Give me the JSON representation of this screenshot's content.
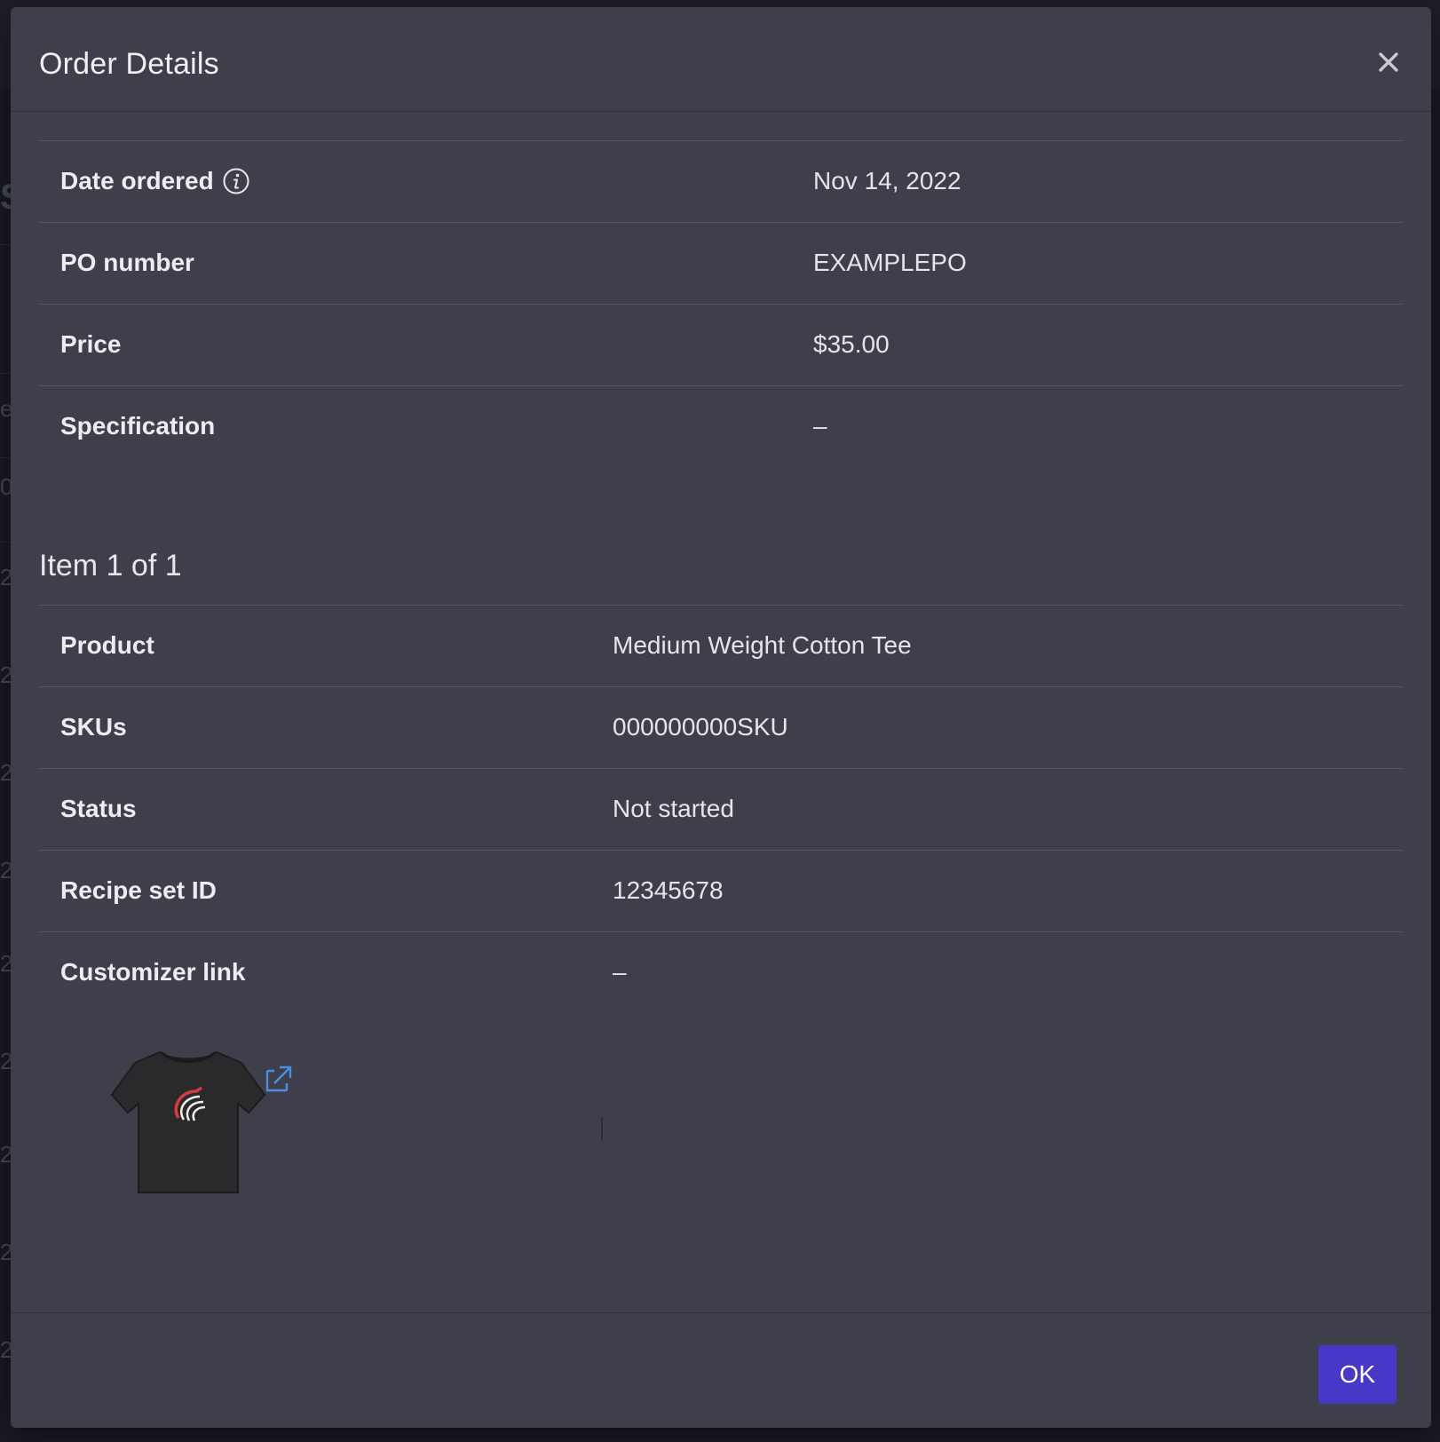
{
  "modal": {
    "title": "Order Details",
    "close_icon": "close-icon"
  },
  "order": {
    "rows": [
      {
        "label": "Date ordered",
        "value": "Nov 14, 2022",
        "has_info_icon": true
      },
      {
        "label": "PO number",
        "value": "EXAMPLEPO"
      },
      {
        "label": "Price",
        "value": "$35.00"
      },
      {
        "label": "Specification",
        "value": "–"
      }
    ]
  },
  "item": {
    "heading": "Item 1 of 1",
    "rows": [
      {
        "label": "Product",
        "value": "Medium Weight Cotton Tee"
      },
      {
        "label": "SKUs",
        "value": "000000000SKU"
      },
      {
        "label": "Status",
        "value": "Not started"
      },
      {
        "label": "Recipe set ID",
        "value": "12345678"
      },
      {
        "label": "Customizer link",
        "value": "–"
      }
    ],
    "thumbnail": "black-tshirt-with-red-logo",
    "external_link_icon": "external-link-icon"
  },
  "footer": {
    "ok_label": "OK"
  },
  "colors": {
    "modal_bg": "#3e3f4a",
    "primary_button": "#4838c8",
    "link_accent": "#4a90e2",
    "divider": "#575867"
  }
}
